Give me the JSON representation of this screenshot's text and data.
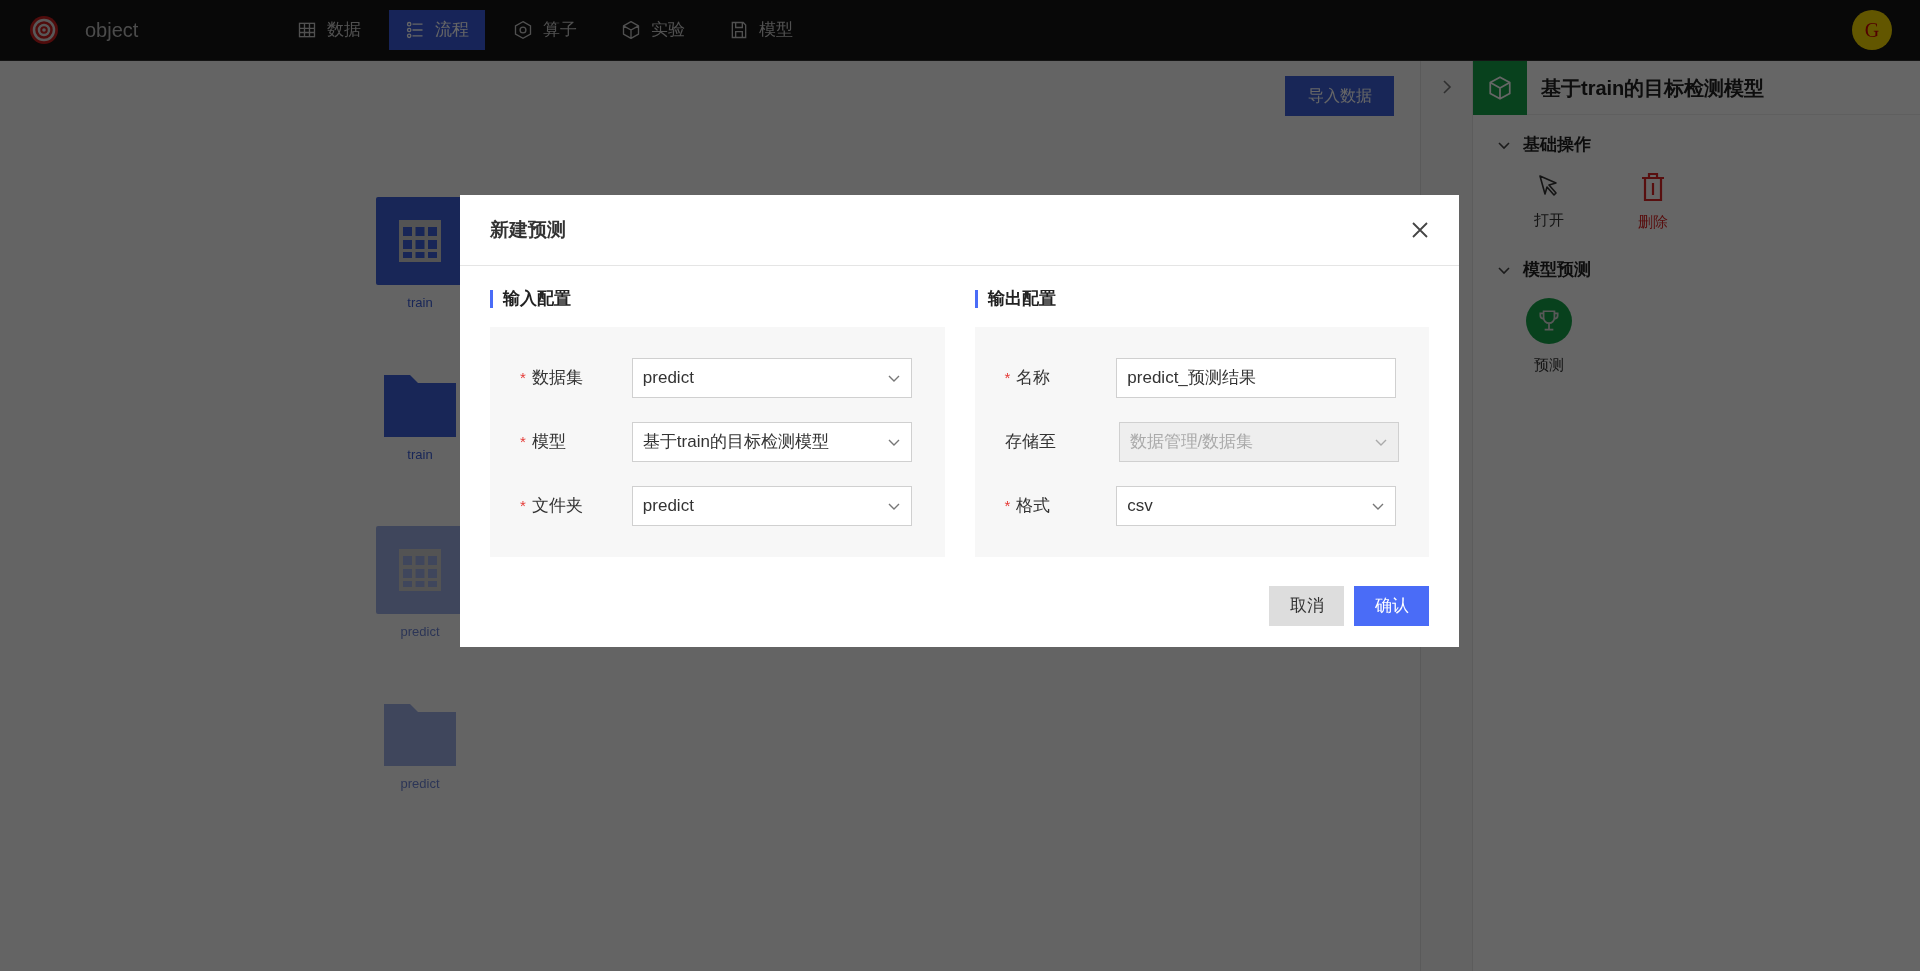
{
  "topbar": {
    "app_name": "object",
    "nav": [
      {
        "label": "数据",
        "selected": false
      },
      {
        "label": "流程",
        "selected": true
      },
      {
        "label": "算子",
        "selected": false
      },
      {
        "label": "实验",
        "selected": false
      },
      {
        "label": "模型",
        "selected": false
      }
    ],
    "avatar": "G"
  },
  "toolbar": {
    "import_button": "导入数据"
  },
  "canvas": {
    "nodes": [
      {
        "kind": "table",
        "label": "train",
        "faded": false
      },
      {
        "kind": "folder",
        "label": "train",
        "faded": false
      },
      {
        "kind": "table",
        "label": "predict",
        "faded": true
      },
      {
        "kind": "folder",
        "label": "predict",
        "faded": true
      }
    ]
  },
  "panel": {
    "title": "基于train的目标检测模型",
    "sections": [
      {
        "title": "基础操作",
        "expanded": true,
        "actions": [
          {
            "label": "打开",
            "kind": "open"
          },
          {
            "label": "删除",
            "kind": "delete"
          }
        ]
      },
      {
        "title": "模型预测",
        "expanded": true,
        "actions": [
          {
            "label": "预测",
            "kind": "predict"
          }
        ]
      }
    ]
  },
  "dialog": {
    "title": "新建预测",
    "columns": [
      {
        "title": "输入配置",
        "fields": [
          {
            "label": "数据集",
            "required_mark": "*",
            "kind": "select",
            "value": "predict",
            "disabled": false
          },
          {
            "label": "模型",
            "required_mark": "*",
            "kind": "select",
            "value": "基于train的目标检测模型",
            "disabled": false
          },
          {
            "label": "文件夹",
            "required_mark": "*",
            "kind": "select",
            "value": "predict",
            "disabled": false
          }
        ]
      },
      {
        "title": "输出配置",
        "fields": [
          {
            "label": "名称",
            "required_mark": "*",
            "kind": "input",
            "value": "predict_预测结果",
            "disabled": false
          },
          {
            "label": "存储至",
            "kind": "select",
            "placeholder": "数据管理/数据集",
            "disabled": true
          },
          {
            "label": "格式",
            "required_mark": "*",
            "kind": "select",
            "value": "csv",
            "disabled": false
          }
        ]
      }
    ],
    "buttons": [
      {
        "label": "取消",
        "kind": "secondary"
      },
      {
        "label": "确认",
        "kind": "primary"
      }
    ]
  }
}
